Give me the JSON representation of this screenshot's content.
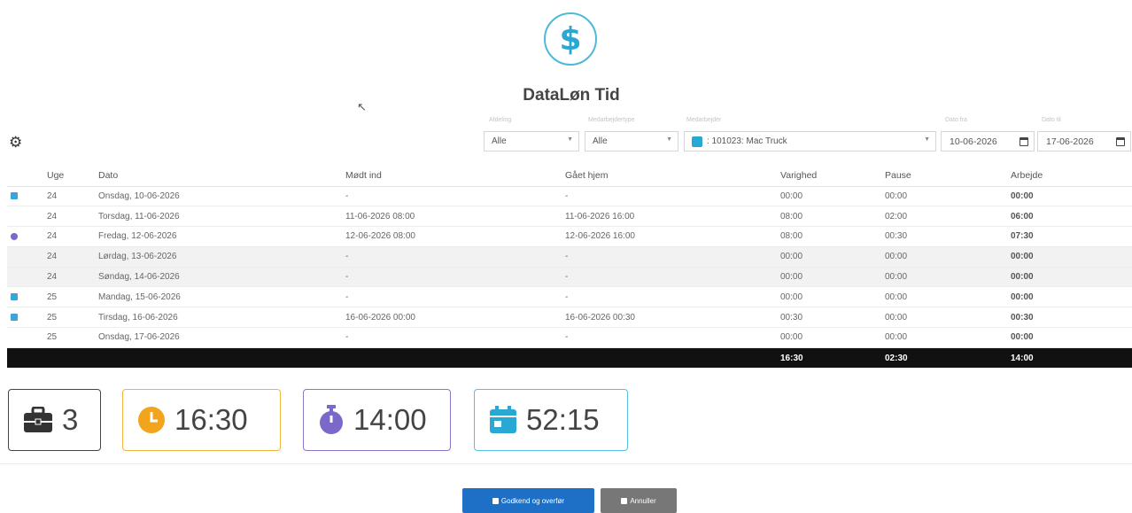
{
  "app": {
    "logo_symbol": "$",
    "title": "DataLøn Tid"
  },
  "filters": {
    "labels": [
      "Afdeling",
      "Medarbejdertype",
      "Medarbejder",
      "Dato fra",
      "Dato til"
    ],
    "afdeling": "Alle",
    "type": "Alle",
    "medarbejder": ": 101023: Mac Truck",
    "date_from": "10-06-2026",
    "date_to": "17-06-2026"
  },
  "table": {
    "headers": [
      "",
      "Uge",
      "Dato",
      "Mødt ind",
      "Gået hjem",
      "Varighed",
      "Pause",
      "Arbejde"
    ],
    "rows": [
      {
        "icon": "calendar-icon",
        "uge": "24",
        "dato": "Onsdag, 10-06-2026",
        "ind": "-",
        "hjem": "-",
        "varighed": "00:00",
        "pause": "00:00",
        "arbejde": "00:00"
      },
      {
        "icon": "",
        "uge": "24",
        "dato": "Torsdag, 11-06-2026",
        "ind": "11-06-2026 08:00",
        "hjem": "11-06-2026 16:00",
        "varighed": "08:00",
        "pause": "02:00",
        "arbejde": "06:00"
      },
      {
        "icon": "stopwatch-icon",
        "uge": "24",
        "dato": "Fredag, 12-06-2026",
        "ind": "12-06-2026 08:00",
        "hjem": "12-06-2026 16:00",
        "varighed": "08:00",
        "pause": "00:30",
        "arbejde": "07:30"
      },
      {
        "icon": "",
        "uge": "24",
        "dato": "Lørdag, 13-06-2026",
        "ind": "-",
        "hjem": "-",
        "varighed": "00:00",
        "pause": "00:00",
        "arbejde": "00:00"
      },
      {
        "icon": "",
        "uge": "24",
        "dato": "Søndag, 14-06-2026",
        "ind": "-",
        "hjem": "-",
        "varighed": "00:00",
        "pause": "00:00",
        "arbejde": "00:00"
      },
      {
        "icon": "calendar-icon",
        "uge": "25",
        "dato": "Mandag, 15-06-2026",
        "ind": "-",
        "hjem": "-",
        "varighed": "00:00",
        "pause": "00:00",
        "arbejde": "00:00"
      },
      {
        "icon": "calendar-icon",
        "uge": "25",
        "dato": "Tirsdag, 16-06-2026",
        "ind": "16-06-2026 00:00",
        "hjem": "16-06-2026 00:30",
        "varighed": "00:30",
        "pause": "00:00",
        "arbejde": "00:30"
      },
      {
        "icon": "",
        "uge": "25",
        "dato": "Onsdag, 17-06-2026",
        "ind": "-",
        "hjem": "-",
        "varighed": "00:00",
        "pause": "00:00",
        "arbejde": "00:00"
      }
    ],
    "totals": {
      "varighed": "16:30",
      "pause": "02:30",
      "arbejde": "14:00"
    }
  },
  "summary": {
    "days": "3",
    "duration": "16:30",
    "work": "14:00",
    "period": "52:15"
  },
  "colors": {
    "accent_blue": "#1d70c6",
    "yellow": "#f2b640",
    "purple": "#8b76cc",
    "cyan": "#55c1e3"
  },
  "buttons": {
    "approve": "Godkend og overfør",
    "cancel": "Annuller"
  }
}
